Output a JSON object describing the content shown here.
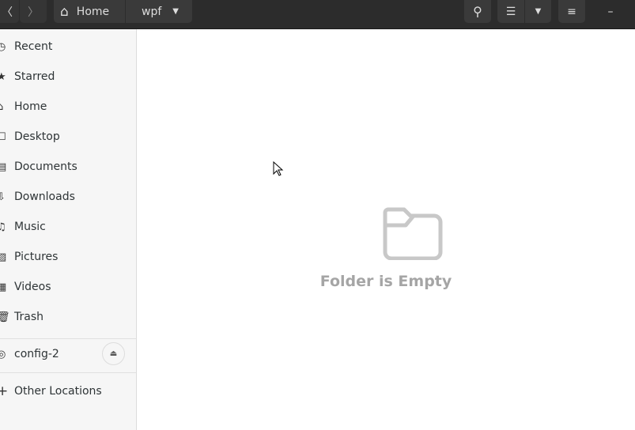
{
  "header": {
    "breadcrumb": [
      "Home",
      "wpf"
    ],
    "back_icon": "chevron-left",
    "forward_icon": "chevron-right"
  },
  "sidebar": {
    "items": [
      {
        "label": "Recent",
        "icon": "clock-icon",
        "glyph": "◷"
      },
      {
        "label": "Starred",
        "icon": "star-icon",
        "glyph": "★"
      },
      {
        "label": "Home",
        "icon": "home-icon",
        "glyph": "⌂"
      },
      {
        "label": "Desktop",
        "icon": "desktop-icon",
        "glyph": "☐"
      },
      {
        "label": "Documents",
        "icon": "document-icon",
        "glyph": "▤"
      },
      {
        "label": "Downloads",
        "icon": "download-icon",
        "glyph": "⇩"
      },
      {
        "label": "Music",
        "icon": "music-icon",
        "glyph": "♫"
      },
      {
        "label": "Pictures",
        "icon": "picture-icon",
        "glyph": "▨"
      },
      {
        "label": "Videos",
        "icon": "video-icon",
        "glyph": "▦"
      },
      {
        "label": "Trash",
        "icon": "trash-icon",
        "glyph": "🗑"
      }
    ],
    "device": {
      "label": "config-2",
      "icon": "disc-icon",
      "glyph": "◎"
    },
    "other": {
      "label": "Other Locations",
      "icon": "plus-icon",
      "glyph": "+"
    }
  },
  "main": {
    "empty_text": "Folder is Empty"
  }
}
